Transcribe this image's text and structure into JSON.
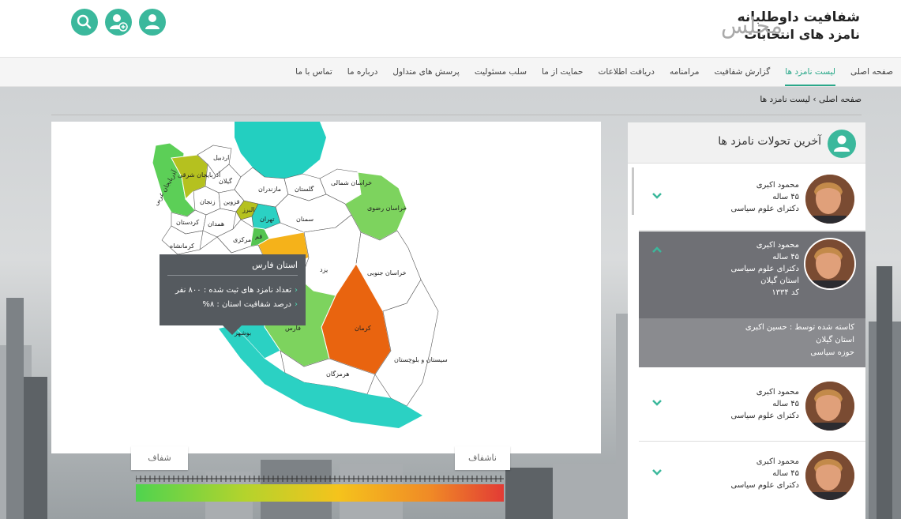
{
  "header": {
    "logo_line1": "شفافیت داوطلبانه",
    "logo_line2": "نامزد های انتخابات",
    "logo_word": "مجلس",
    "buttons": [
      {
        "icon": "user-icon"
      },
      {
        "icon": "add-user-icon"
      },
      {
        "icon": "search-icon"
      }
    ]
  },
  "nav": {
    "items": [
      {
        "label": "صفحه اصلی",
        "active": false
      },
      {
        "label": "لیست نامزد ها",
        "active": true
      },
      {
        "label": "گزارش شفافیت",
        "active": false
      },
      {
        "label": "مرامنامه",
        "active": false
      },
      {
        "label": "دریافت اطلاعات",
        "active": false
      },
      {
        "label": "حمایت از ما",
        "active": false
      },
      {
        "label": "سلب مسئولیت",
        "active": false
      },
      {
        "label": "پرسش های متداول",
        "active": false
      },
      {
        "label": "درباره ما",
        "active": false
      },
      {
        "label": "تماس با ما",
        "active": false
      }
    ]
  },
  "breadcrumb": {
    "home": "صفحه اصلی",
    "current": "لیست نامزد ها"
  },
  "map": {
    "province_labels": {
      "azarbayjan_sharghi": "آذربایجان شرقی",
      "azarbayjan_gharbi": "آذربایجان غربی",
      "ardabil": "اردبیل",
      "zanjan": "زنجان",
      "gilan": "گیلان",
      "qazvin": "قزوین",
      "kordestan": "کردستان",
      "hamedan": "همدان",
      "kermanshah": "کرمانشاه",
      "markazi": "مرکزی",
      "qom": "قم",
      "tehran": "تهران",
      "alborz": "البرز",
      "mazandaran": "مازندران",
      "golestan": "گلستان",
      "khorasan_shomali": "خراسان شمالی",
      "khorasan_razavi": "خراسان رضوی",
      "khorasan_jonubi": "خراسان جنوبی",
      "semnan": "سمنان",
      "yazd": "یزد",
      "kerman": "کرمان",
      "fars": "فارس",
      "bushehr": "بوشهر",
      "hormozgan": "هرمزگان",
      "sistan": "سیستان و بلوچستان"
    },
    "colors": {
      "azarbayjan_gharbi": "#5ccf57",
      "azarbayjan_sharghi": "#b5c11f",
      "ardabil": "#ffffff",
      "caspian": "#23cfc0",
      "khorasan_razavi": "#7dd35e",
      "tehran": "#2bd1c3",
      "alborz": "#b5c11f",
      "qom": "#55c451",
      "semnan_tip": "#f5b21a",
      "kerman": "#e9640f",
      "fars": "#7dd35e",
      "bushehr": "#2bd1c3",
      "persian_gulf": "#2bd1c3",
      "default": "#ffffff"
    },
    "tooltip": {
      "title": "استان فارس",
      "line1": "تعداد نامزد های ثبت شده : ۸۰۰ نفر",
      "line2": "درصد شفافیت استان : ۸%"
    }
  },
  "legend": {
    "transparent_label": "شفاف",
    "opaque_label": "ناشفاف",
    "gradient_colors": [
      "#4fd34f",
      "#b5d32c",
      "#f5c31c",
      "#f08a26",
      "#e23b35"
    ]
  },
  "side": {
    "title": "آخرین تحولات نامزد ها",
    "candidates": [
      {
        "name": "محمود اکبری",
        "age": "۴۵ ساله",
        "degree": "دکترای علوم سیاسی",
        "expanded": false
      },
      {
        "name": "محمود اکبری",
        "age": "۴۵ ساله",
        "degree": "دکترای علوم سیاسی",
        "province": "استان گیلان",
        "code": "کد ۱۳۳۴",
        "expanded": true,
        "details": {
          "line1": "کاسته شده توسط : حسین اکبری",
          "line2": "استان گیلان",
          "line3": "حوزه سیاسی"
        }
      },
      {
        "name": "محمود اکبری",
        "age": "۴۵ ساله",
        "degree": "دکترای علوم سیاسی",
        "expanded": false
      },
      {
        "name": "محمود اکبری",
        "age": "۴۵ ساله",
        "degree": "دکترای علوم سیاسی",
        "expanded": false
      }
    ]
  }
}
